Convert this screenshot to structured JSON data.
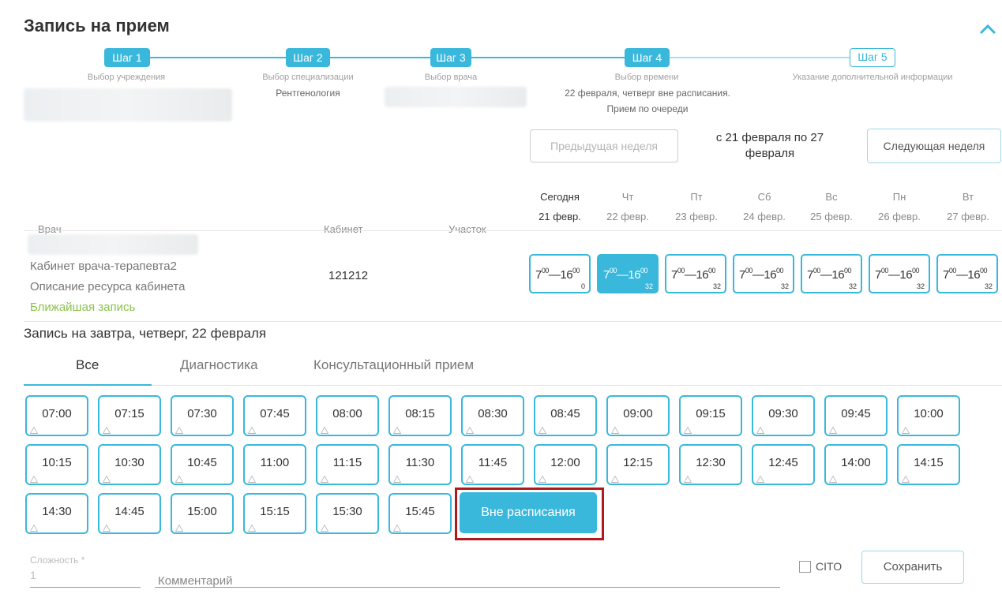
{
  "title": "Запись на прием",
  "steps": [
    {
      "label": "Шаг 1",
      "caption": "Выбор учреждения",
      "value": ""
    },
    {
      "label": "Шаг 2",
      "caption": "Выбор специализации",
      "value": "Рентгенология"
    },
    {
      "label": "Шаг 3",
      "caption": "Выбор врача",
      "value": ""
    },
    {
      "label": "Шаг 4",
      "caption": "Выбор времени",
      "value": "22 февраля, четверг вне расписания.",
      "value2": "Прием по очереди"
    },
    {
      "label": "Шаг 5",
      "caption": "Указание дополнительной информации",
      "value": ""
    }
  ],
  "week_nav": {
    "prev": "Предыдущая неделя",
    "range": "с 21 февраля по 27 февраля",
    "next": "Следующая неделя"
  },
  "columns": {
    "doctor": "Врач",
    "cabinet": "Кабинет",
    "district": "Участок"
  },
  "days": [
    {
      "weekday": "Сегодня",
      "date": "21 февр."
    },
    {
      "weekday": "Чт",
      "date": "22 февр."
    },
    {
      "weekday": "Пт",
      "date": "23 февр."
    },
    {
      "weekday": "Сб",
      "date": "24 февр."
    },
    {
      "weekday": "Вс",
      "date": "25 февр."
    },
    {
      "weekday": "Пн",
      "date": "26 февр."
    },
    {
      "weekday": "Вт",
      "date": "27 февр."
    }
  ],
  "resource": {
    "cabinet_name": "Кабинет врача-терапевта2",
    "description": "Описание ресурса кабинета",
    "nearest": "Ближайшая запись",
    "cabinet_no": "121212"
  },
  "day_slots": [
    {
      "from": "7",
      "from_min": "00",
      "to": "16",
      "to_min": "00",
      "count": "0"
    },
    {
      "from": "7",
      "from_min": "00",
      "to": "16",
      "to_min": "00",
      "count": "32"
    },
    {
      "from": "7",
      "from_min": "00",
      "to": "16",
      "to_min": "00",
      "count": "32"
    },
    {
      "from": "7",
      "from_min": "00",
      "to": "16",
      "to_min": "00",
      "count": "32"
    },
    {
      "from": "7",
      "from_min": "00",
      "to": "16",
      "to_min": "00",
      "count": "32"
    },
    {
      "from": "7",
      "from_min": "00",
      "to": "16",
      "to_min": "00",
      "count": "32"
    },
    {
      "from": "7",
      "from_min": "00",
      "to": "16",
      "to_min": "00",
      "count": "32"
    }
  ],
  "booking_title": "Запись на завтра, четверг, 22 февраля",
  "tabs": [
    "Все",
    "Диагностика",
    "Консультационный прием"
  ],
  "times": [
    "07:00",
    "07:15",
    "07:30",
    "07:45",
    "08:00",
    "08:15",
    "08:30",
    "08:45",
    "09:00",
    "09:15",
    "09:30",
    "09:45",
    "10:00",
    "10:15",
    "10:30",
    "10:45",
    "11:00",
    "11:15",
    "11:30",
    "11:45",
    "12:00",
    "12:15",
    "12:30",
    "12:45",
    "14:00",
    "14:15",
    "14:30",
    "14:45",
    "15:00",
    "15:15",
    "15:30",
    "15:45"
  ],
  "extra_button": "Вне расписания",
  "form": {
    "complexity_label": "Сложность *",
    "complexity_value": "1",
    "comment_placeholder": "Комментарий",
    "cito": "CITO",
    "save": "Сохранить"
  },
  "colors": {
    "accent": "#3ab8dc",
    "highlight": "#b0191e",
    "nearest": "#8bc34a"
  }
}
